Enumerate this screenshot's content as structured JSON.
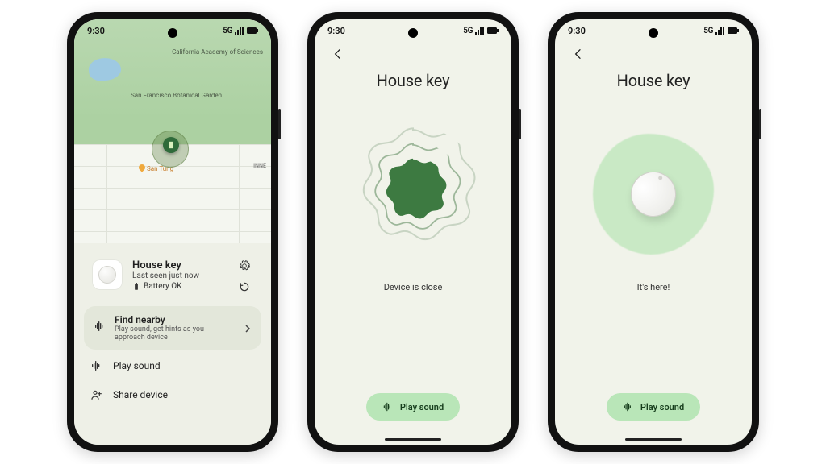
{
  "statusbar": {
    "time": "9:30",
    "network": "5G"
  },
  "phone1": {
    "map": {
      "poi_california_academy": "California Academy\nof Sciences",
      "poi_botanical_garden": "San Francisco\nBotanical\nGarden",
      "poi_san_tung": "San Tung",
      "poi_inner": "INNE"
    },
    "device": {
      "name": "House key",
      "last_seen": "Last seen just now",
      "battery_status": "Battery OK"
    },
    "find_nearby": {
      "title": "Find nearby",
      "subtitle": "Play sound, get hints as you approach device"
    },
    "actions": {
      "play_sound": "Play sound",
      "share_device": "Share device"
    }
  },
  "phone2": {
    "title": "House key",
    "status": "Device is close",
    "play_label": "Play sound"
  },
  "phone3": {
    "title": "House key",
    "status": "It's here!",
    "play_label": "Play sound"
  },
  "colors": {
    "screen_bg": "#f1f3ea",
    "blob_dark": "#3d7a41",
    "blob_light": "#c9e9c5",
    "play_btn": "#b9e6b8"
  }
}
